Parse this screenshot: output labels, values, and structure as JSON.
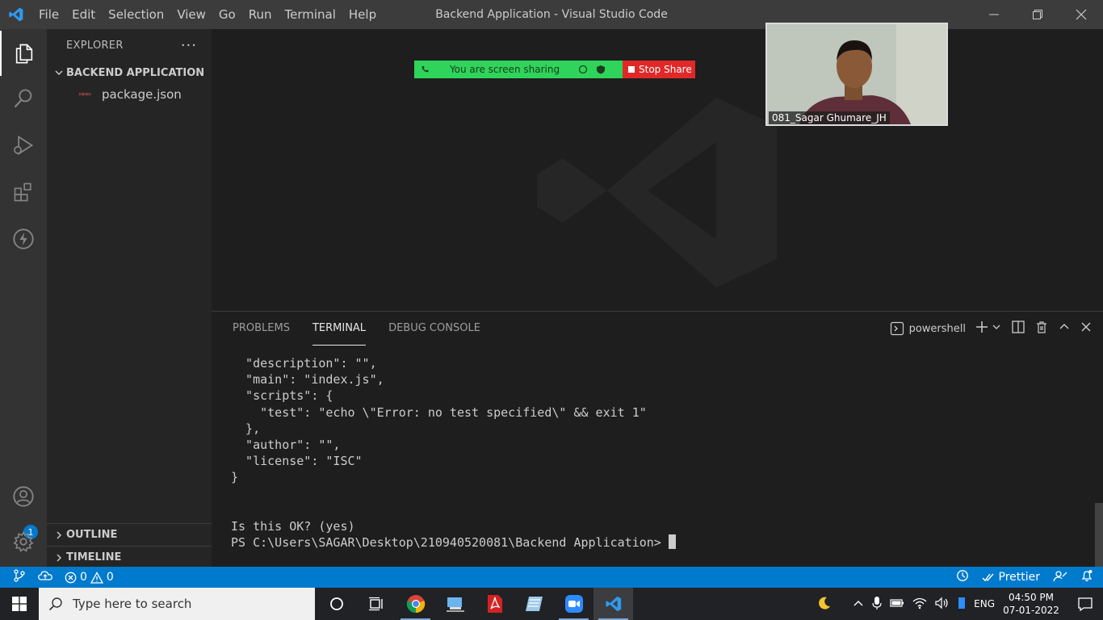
{
  "window": {
    "title": "Backend Application - Visual Studio Code",
    "menu": [
      "File",
      "Edit",
      "Selection",
      "View",
      "Go",
      "Run",
      "Terminal",
      "Help"
    ]
  },
  "sidebar": {
    "header": "EXPLORER",
    "more": "···",
    "folder": "BACKEND APPLICATION",
    "files": [
      {
        "name": "package.json",
        "icon": "npm-icon"
      }
    ],
    "outline": "OUTLINE",
    "timeline": "TIMELINE"
  },
  "activity": {
    "accounts_badge": "1"
  },
  "zoom": {
    "sharing_text": "You are screen sharing",
    "stop_share": "Stop Share",
    "participant_name": "081_Sagar Ghumare_JH"
  },
  "panel": {
    "tabs": [
      "PROBLEMS",
      "TERMINAL",
      "DEBUG CONSOLE"
    ],
    "active_tab": "TERMINAL",
    "shell": "powershell"
  },
  "terminal": {
    "lines": [
      "  \"description\": \"\",",
      "  \"main\": \"index.js\",",
      "  \"scripts\": {",
      "    \"test\": \"echo \\\"Error: no test specified\\\" && exit 1\"",
      "  },",
      "  \"author\": \"\",",
      "  \"license\": \"ISC\"",
      "}",
      "",
      "",
      "Is this OK? (yes)"
    ],
    "prompt": "PS C:\\Users\\SAGAR\\Desktop\\210940520081\\Backend Application> "
  },
  "statusbar": {
    "errors": "0",
    "warnings": "0",
    "prettier": "Prettier"
  },
  "taskbar": {
    "search_placeholder": "Type here to search",
    "language": "ENG",
    "time": "04:50 PM",
    "date": "07-01-2022"
  },
  "colors": {
    "accent": "#007acc",
    "titlebar": "#3c3c3c",
    "activitybar": "#333333",
    "sidebar": "#252526",
    "editor": "#1e1e1e",
    "share_green": "#2fd45a",
    "share_red": "#e02828"
  }
}
